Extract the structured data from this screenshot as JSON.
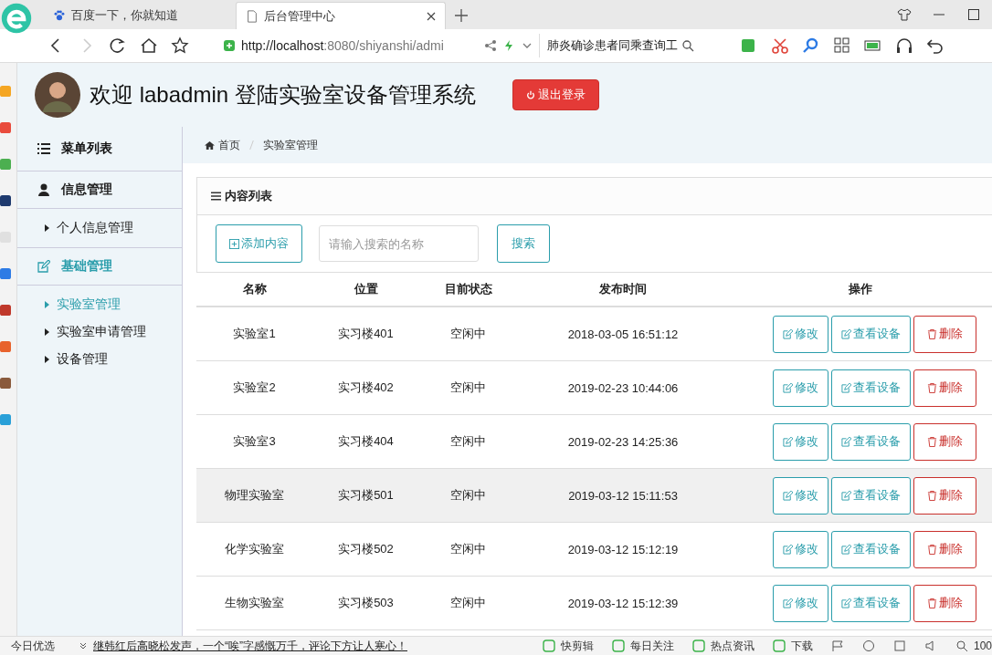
{
  "browser": {
    "tabs": [
      {
        "title": "百度一下，你就知道",
        "selected": false,
        "kind": "paw"
      },
      {
        "title": "后台管理中心",
        "selected": true,
        "kind": "page"
      }
    ],
    "url": {
      "host": "http://localhost",
      "rest": ":8080/shiyanshi/admi"
    },
    "search_text": "肺炎确诊患者同乘查询工"
  },
  "header": {
    "welcome": "欢迎 labadmin 登陆实验室设备管理系统",
    "logout": "退出登录"
  },
  "sidebar": {
    "title": "菜单列表",
    "groups": [
      {
        "title": "信息管理",
        "kind": "user",
        "active": false,
        "items": [
          {
            "label": "个人信息管理",
            "selected": false
          }
        ]
      },
      {
        "title": "基础管理",
        "kind": "edit",
        "active": true,
        "items": [
          {
            "label": "实验室管理",
            "selected": true
          },
          {
            "label": "实验室申请管理",
            "selected": false
          },
          {
            "label": "设备管理",
            "selected": false
          }
        ]
      }
    ]
  },
  "breadcrumb": [
    {
      "label": "首页",
      "kind": "home"
    },
    {
      "label": "实验室管理",
      "kind": "plain"
    }
  ],
  "panel": {
    "title": "内容列表",
    "add_button": "添加内容",
    "search": {
      "placeholder": "请输入搜索的名称"
    },
    "search_button": "搜索"
  },
  "table": {
    "columns": [
      "名称",
      "位置",
      "目前状态",
      "发布时间",
      "操作"
    ],
    "rows": [
      {
        "cells": [
          "实验室1",
          "实习楼401",
          "空闲中",
          "2018-03-05 16:51:12"
        ],
        "actions": [
          "修改",
          "查看设备",
          "删除"
        ],
        "highlighted": false
      },
      {
        "cells": [
          "实验室2",
          "实习楼402",
          "空闲中",
          "2019-02-23 10:44:06"
        ],
        "actions": [
          "修改",
          "查看设备",
          "删除"
        ],
        "highlighted": false
      },
      {
        "cells": [
          "实验室3",
          "实习楼404",
          "空闲中",
          "2019-02-23 14:25:36"
        ],
        "actions": [
          "修改",
          "查看设备",
          "删除"
        ],
        "highlighted": false
      },
      {
        "cells": [
          "物理实验室",
          "实习楼501",
          "空闲中",
          "2019-03-12 15:11:53"
        ],
        "actions": [
          "修改",
          "查看设备",
          "删除"
        ],
        "highlighted": true
      },
      {
        "cells": [
          "化学实验室",
          "实习楼502",
          "空闲中",
          "2019-03-12 15:12:19"
        ],
        "actions": [
          "修改",
          "查看设备",
          "删除"
        ],
        "highlighted": false
      },
      {
        "cells": [
          "生物实验室",
          "实习楼503",
          "空闲中",
          "2019-03-12 15:12:39"
        ],
        "actions": [
          "修改",
          "查看设备",
          "删除"
        ],
        "highlighted": false
      }
    ]
  },
  "status_bar": {
    "left": "今日优选",
    "news": "继韩红后高晓松发声，一个“唉”字感慨万千，评论下方让人寒心！",
    "items": [
      "快剪辑",
      "每日关注",
      "热点资讯",
      "下载"
    ],
    "zoom": "100"
  }
}
